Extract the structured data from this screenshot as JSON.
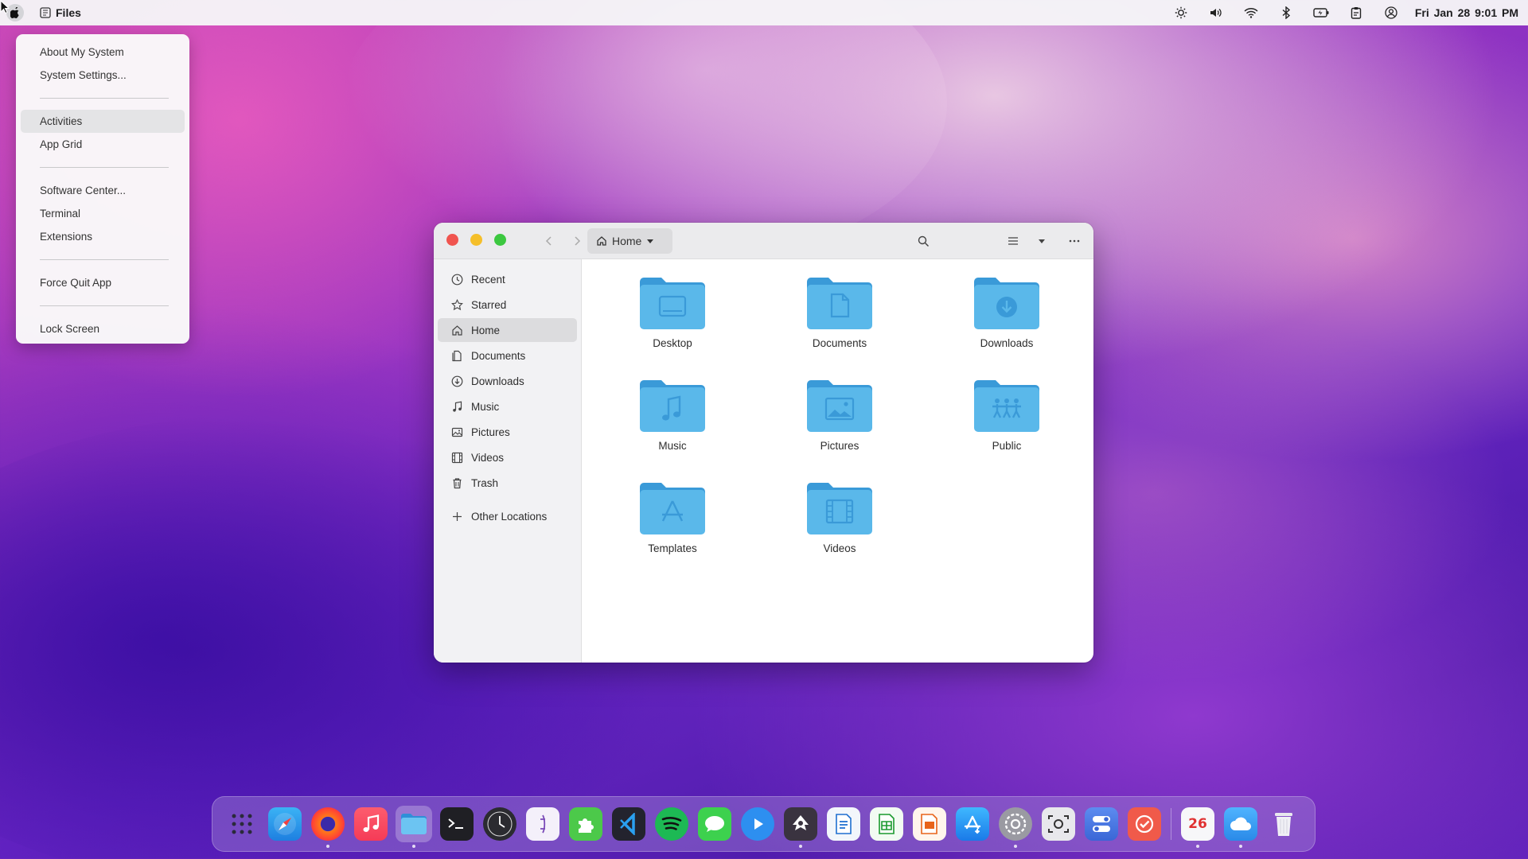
{
  "topbar": {
    "app_name": "Files",
    "clock": "Fri Jan 28  9:01 PM",
    "tray_icons": [
      "brightness-icon",
      "volume-icon",
      "wifi-icon",
      "bluetooth-icon",
      "battery-icon",
      "clipboard-icon",
      "user-icon"
    ]
  },
  "apple_menu": {
    "items": [
      "About My System",
      "System Settings...",
      "Activities",
      "App Grid",
      "Software Center...",
      "Terminal",
      "Extensions",
      "Force Quit App",
      "Lock Screen"
    ],
    "active": "Activities"
  },
  "window": {
    "path_label": "Home",
    "sidebar": [
      {
        "label": "Recent",
        "icon": "clock-icon"
      },
      {
        "label": "Starred",
        "icon": "star-icon"
      },
      {
        "label": "Home",
        "icon": "home-icon"
      },
      {
        "label": "Documents",
        "icon": "document-icon"
      },
      {
        "label": "Downloads",
        "icon": "download-icon"
      },
      {
        "label": "Music",
        "icon": "music-icon"
      },
      {
        "label": "Pictures",
        "icon": "picture-icon"
      },
      {
        "label": "Videos",
        "icon": "film-icon"
      },
      {
        "label": "Trash",
        "icon": "trash-icon"
      },
      {
        "label": "Other Locations",
        "icon": "plus-icon"
      }
    ],
    "sidebar_active": "Home",
    "folders": [
      "Desktop",
      "Documents",
      "Downloads",
      "Music",
      "Pictures",
      "Public",
      "Templates",
      "Videos"
    ]
  },
  "dock": {
    "apps": [
      "app-grid",
      "safari",
      "firefox",
      "music",
      "files",
      "terminal",
      "clock",
      "text-editor",
      "extensions",
      "vscode",
      "spotify",
      "messages",
      "video-player",
      "inkscape",
      "writer",
      "calc",
      "impress",
      "app-store",
      "system-settings",
      "screenshot",
      "tweaks",
      "tasks",
      "calendar",
      "weather",
      "trash"
    ],
    "calendar_day": "26"
  },
  "colors": {
    "folder_body": "#5ab8ea",
    "folder_tab": "#3a9ad8",
    "close": "#f0544f",
    "minimize": "#f5bf2a",
    "maximize": "#3cc840"
  }
}
